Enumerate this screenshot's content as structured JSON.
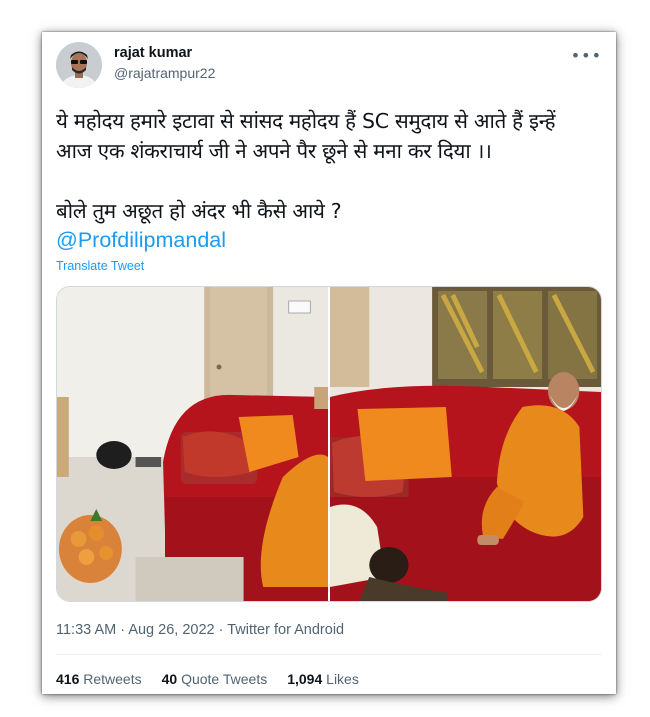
{
  "author": {
    "display_name": "rajat kumar",
    "handle": "@rajatrampur22"
  },
  "tweet": {
    "text": "ये महोदय हमारे इटावा से सांसद महोदय हैं SC समुदाय से आते हैं इन्हें\nआज एक शंकराचार्य जी ने अपने पैर छूने से मना कर दिया ।।\n\nबोले तुम अछूत हो अंदर भी कैसे आये ?",
    "mention": "@Profdilipmandal",
    "translate_label": "Translate Tweet"
  },
  "meta": {
    "time": "11:33 AM",
    "date": "Aug 26, 2022",
    "source": "Twitter for Android",
    "separator": "·"
  },
  "stats": {
    "retweets_count": "416",
    "retweets_label": "Retweets",
    "quotes_count": "40",
    "quotes_label": "Quote Tweets",
    "likes_count": "1,094",
    "likes_label": "Likes"
  },
  "more_icon": "more-horizontal-icon",
  "colors": {
    "link": "#1d9bf0",
    "text": "#0f1419",
    "muted": "#536471",
    "sofa": "#b5141c",
    "robe": "#e8891c"
  }
}
